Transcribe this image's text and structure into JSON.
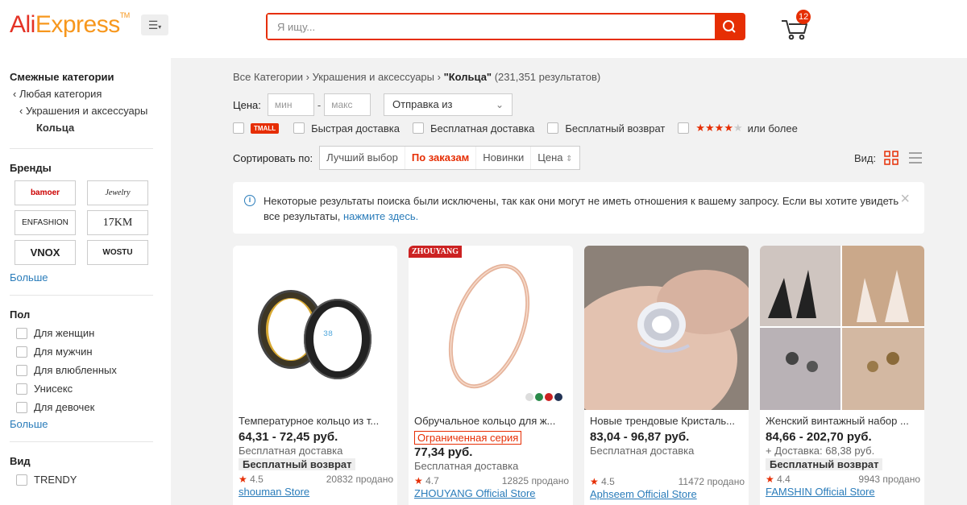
{
  "header": {
    "logo_ali": "Ali",
    "logo_express": "Express",
    "logo_tm": "TM",
    "menu_icon": "menu-icon",
    "search_placeholder": "Я ищу...",
    "cart_count": "12"
  },
  "sidebar": {
    "related_title": "Смежные категории",
    "related_links": [
      "Любая категория",
      "Украшения и аксессуары",
      "Кольца"
    ],
    "brands_title": "Бренды",
    "brands": [
      "bamoer",
      "Jewelry",
      "ENFASHION",
      "17KM",
      "VNOX",
      "WOSTU"
    ],
    "brands_more": "Больше",
    "gender_title": "Пол",
    "gender_options": [
      "Для женщин",
      "Для мужчин",
      "Для влюбленных",
      "Унисекс",
      "Для девочек"
    ],
    "gender_more": "Больше",
    "view_title": "Вид",
    "view_options": [
      "TRENDY"
    ]
  },
  "main": {
    "breadcrumb": {
      "all": "Все Категории",
      "parent": "Украшения и аксессуары",
      "current": "\"Кольца\"",
      "count": "(231,351 результатов)"
    },
    "price_label": "Цена:",
    "price_min_placeholder": "мин",
    "price_max_placeholder": "макс",
    "price_sep": "-",
    "ship_from": "Отправка из",
    "filters": {
      "tmall": "TMALL",
      "fast": "Быстрая доставка",
      "free_ship": "Бесплатная доставка",
      "free_return": "Бесплатный возврат",
      "rating_suffix": "или более"
    },
    "sort": {
      "label": "Сортировать по:",
      "options": [
        "Лучший выбор",
        "По заказам",
        "Новинки",
        "Цена"
      ]
    },
    "view_label": "Вид:",
    "notice": {
      "text": "Некоторые результаты поиска были исключены, так как они могут не иметь отношения к вашему запросу. Если вы хотите увидеть все результаты,",
      "link": "нажмите здесь."
    }
  },
  "products": [
    {
      "title": "Температурное кольцо из т...",
      "price": "64,31 - 72,45 руб.",
      "shipping": "Бесплатная доставка",
      "badge": "Бесплатный возврат",
      "rating": "4.5",
      "sold": "20832 продано",
      "store": "shouman Store"
    },
    {
      "title": "Обручальное кольцо для ж...",
      "label_limited": "Ограниченная серия",
      "price": "77,34 руб.",
      "shipping": "Бесплатная доставка",
      "rating": "4.7",
      "sold": "12825 продано",
      "store": "ZHOUYANG Official Store",
      "brand_tag": "ZHOUYANG"
    },
    {
      "title": "Новые трендовые Кристаль...",
      "price": "83,04 - 96,87 руб.",
      "shipping": "Бесплатная доставка",
      "rating": "4.5",
      "sold": "11472 продано",
      "store": "Aphseem Official Store"
    },
    {
      "title": "Женский винтажный набор ...",
      "price": "84,66 - 202,70 руб.",
      "shipping": "+ Доставка: 68,38 руб.",
      "badge": "Бесплатный возврат",
      "rating": "4.4",
      "sold": "9943 продано",
      "store": "FAMSHIN Official Store"
    }
  ],
  "colors": {
    "brand_red": "#e62e04",
    "logo_red": "#e43225",
    "logo_orange": "#f7971d",
    "link_blue": "#2a7cba"
  }
}
